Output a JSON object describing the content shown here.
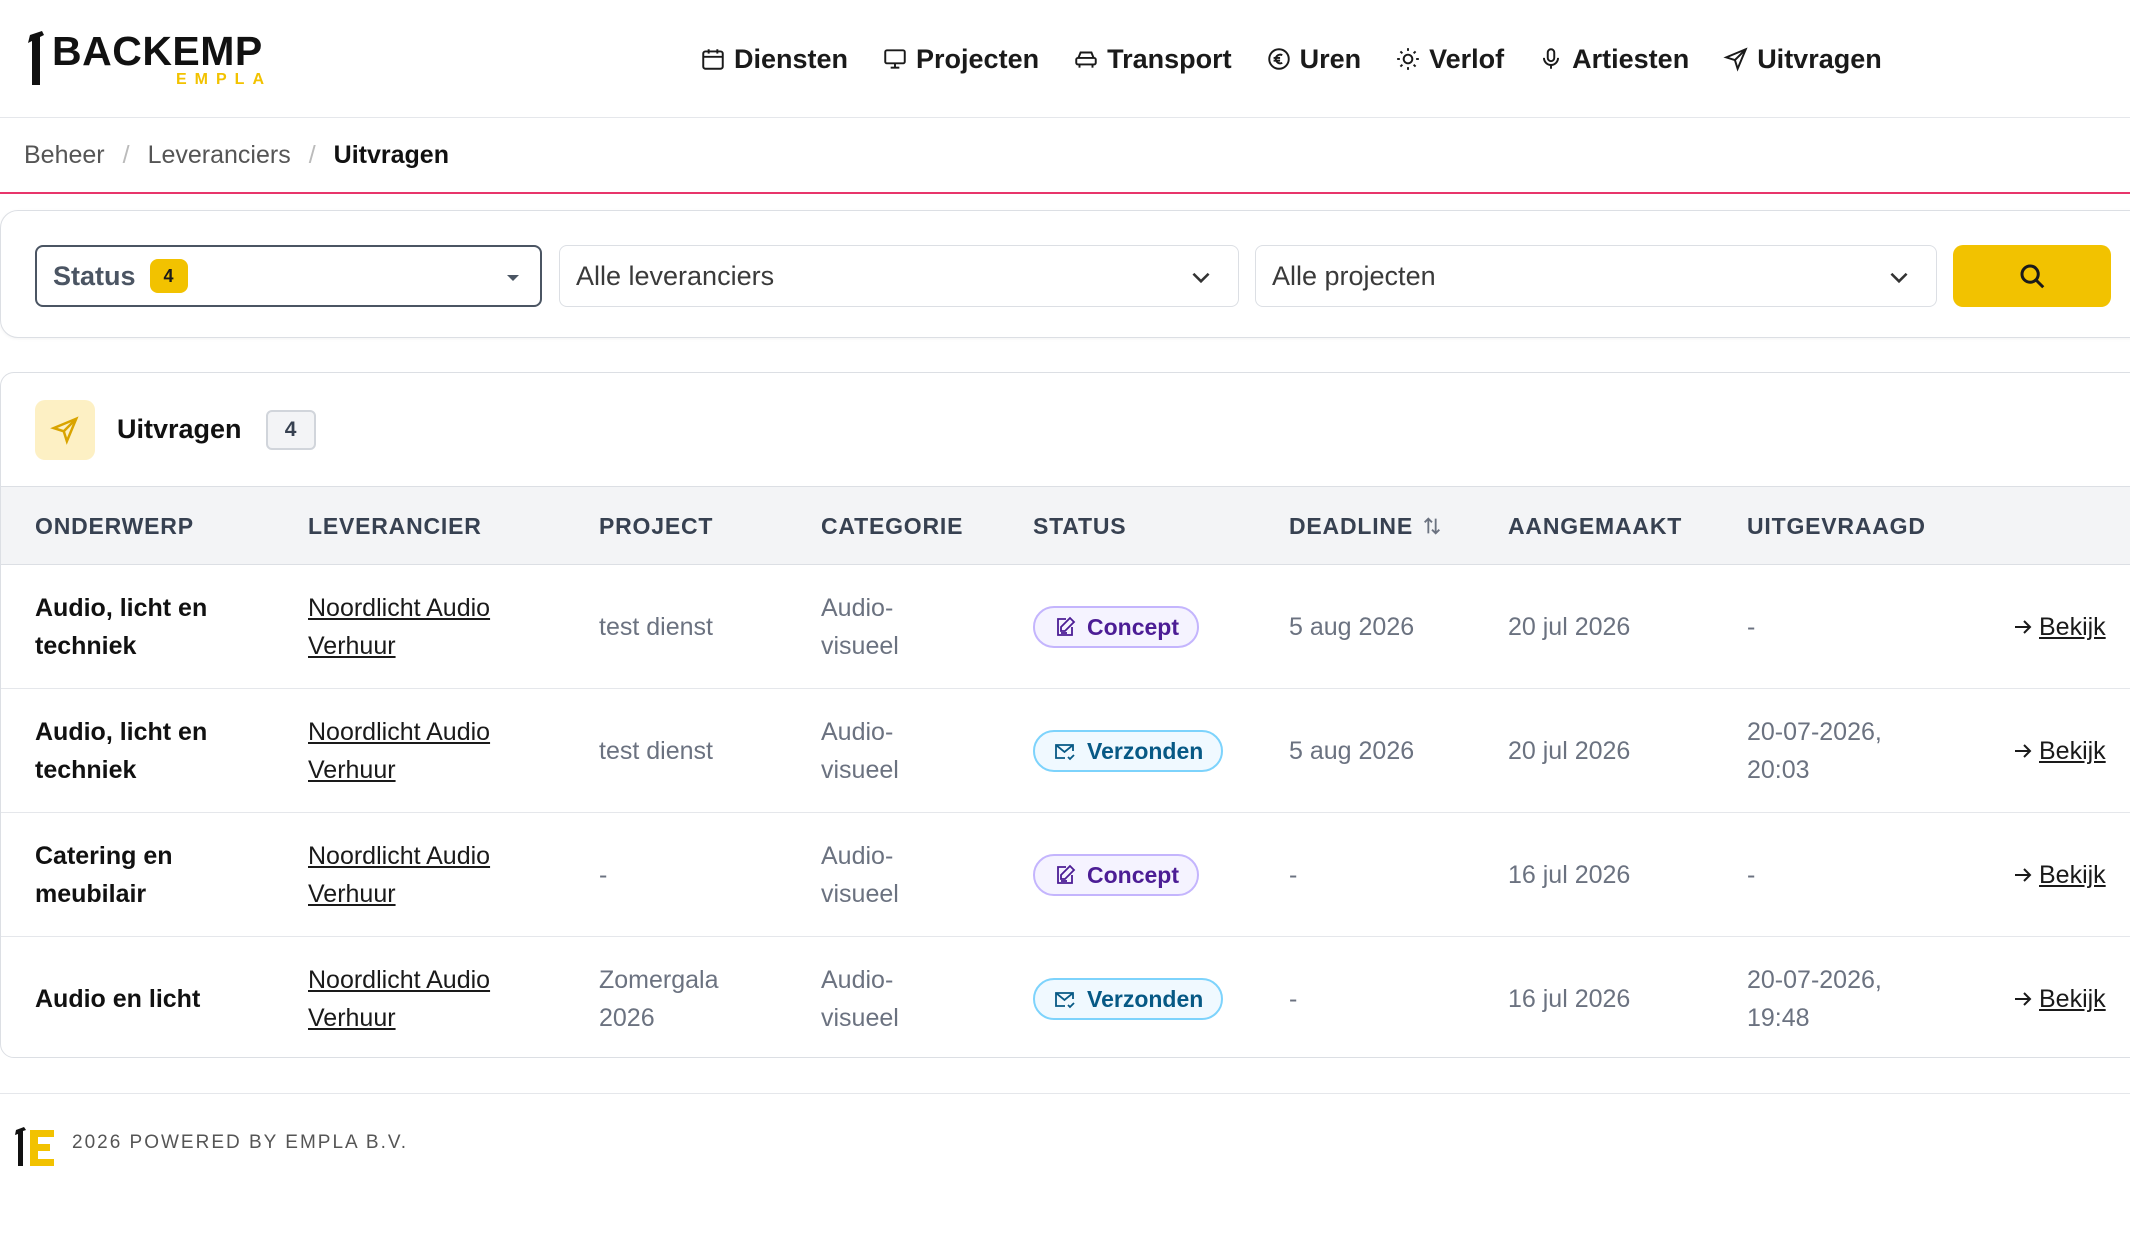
{
  "brand": {
    "name": "BACKEMP",
    "sub": "EMPLA"
  },
  "nav": [
    {
      "label": "Diensten",
      "icon": "calendar-icon"
    },
    {
      "label": "Projecten",
      "icon": "monitor-icon"
    },
    {
      "label": "Transport",
      "icon": "car-icon"
    },
    {
      "label": "Uren",
      "icon": "euro-icon"
    },
    {
      "label": "Verlof",
      "icon": "sun-icon"
    },
    {
      "label": "Artiesten",
      "icon": "microphone-icon"
    },
    {
      "label": "Uitvragen",
      "icon": "send-icon"
    }
  ],
  "breadcrumb": [
    "Beheer",
    "Leveranciers",
    "Uitvragen"
  ],
  "filters": {
    "status_label": "Status",
    "status_count": "4",
    "supplier_value": "Alle leveranciers",
    "project_value": "Alle projecten"
  },
  "table_card": {
    "title": "Uitvragen",
    "count": "4",
    "columns": [
      "Onderwerp",
      "Leverancier",
      "Project",
      "Categorie",
      "Status",
      "Deadline",
      "Aangemaakt",
      "Uitgevraagd"
    ],
    "rows": [
      {
        "subject": "Audio, licht en techniek",
        "supplier": "Noordlicht Audio Verhuur",
        "project": "test dienst",
        "category": "Audio-visueel",
        "status": "Concept",
        "deadline": "5 aug 2026",
        "created": "20 jul 2026",
        "requested": "-",
        "action": "Bekijk"
      },
      {
        "subject": "Audio, licht en techniek",
        "supplier": "Noordlicht Audio Verhuur",
        "project": "test dienst",
        "category": "Audio-visueel",
        "status": "Verzonden",
        "deadline": "5 aug 2026",
        "created": "20 jul 2026",
        "requested": "20-07-2026, 20:03",
        "action": "Bekijk"
      },
      {
        "subject": "Catering en meubilair",
        "supplier": "Noordlicht Audio Verhuur",
        "project": "-",
        "category": "Audio-visueel",
        "status": "Concept",
        "deadline": "-",
        "created": "16 jul 2026",
        "requested": "-",
        "action": "Bekijk"
      },
      {
        "subject": "Audio en licht",
        "supplier": "Noordlicht Audio Verhuur",
        "project": "Zomergala 2026",
        "category": "Audio-visueel",
        "status": "Verzonden",
        "deadline": "-",
        "created": "16 jul 2026",
        "requested": "20-07-2026, 19:48",
        "action": "Bekijk"
      }
    ]
  },
  "footer": {
    "text": "2026 POWERED BY EMPLA B.V."
  },
  "colors": {
    "accent": "#f2c200",
    "divider": "#e8356b",
    "concept": "#4c1d95",
    "sent": "#075985"
  }
}
